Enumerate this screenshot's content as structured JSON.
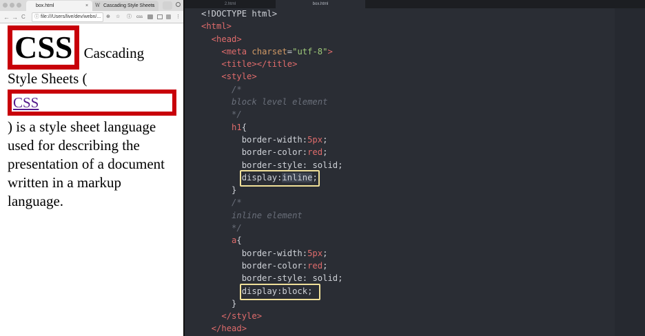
{
  "browser": {
    "tabs": [
      {
        "label": "box.html",
        "active": true,
        "close": "×"
      },
      {
        "label": "Cascading Style Sheets",
        "active": false,
        "close": "×",
        "favicon": "W"
      }
    ],
    "nav": {
      "back": "←",
      "forward": "→",
      "reload": "C"
    },
    "address": {
      "info_icon": "ⓘ",
      "url": "file:///Users/live/dev/webn/..."
    },
    "toolbar_icons": {
      "zoom": "⊕",
      "star": "☆",
      "info": "ⓘ",
      "ext": "css",
      "menu": "⋮"
    },
    "page": {
      "h1": "CSS",
      "text_before": "Cascading Style Sheets (",
      "link": "CSS",
      "text_after": ") is a style sheet language used for describing the presentation of a document written in a markup language."
    }
  },
  "editor": {
    "tabs": [
      {
        "label": "2.html",
        "active": false
      },
      {
        "label": "box.html",
        "active": true
      }
    ],
    "code": {
      "doctype": "<!DOCTYPE html>",
      "html_open": "<html>",
      "head_open": "<head>",
      "meta_lt": "<",
      "meta_tag": "meta",
      "meta_attr": "charset",
      "meta_eq": "=",
      "meta_val": "\"utf-8\"",
      "meta_gt": ">",
      "title_tags": "<title></title>",
      "style_open": "<style>",
      "comment_open": "/*",
      "comment1": "block level element",
      "comment_close": "*/",
      "h1_selector": "h1",
      "open_brace": "{",
      "bw_prop": "border-width:",
      "bw_val": "5px",
      "bc_prop": "border-color:",
      "bc_val": "red",
      "bs_prop": "border-style:",
      "bs_val": "solid",
      "semi": ";",
      "disp_prop": "display:",
      "disp_inline": "inline",
      "close_brace": "}",
      "comment2": "inline element",
      "a_selector": "a",
      "disp_block": "block",
      "style_close": "</style>",
      "head_close": "</head>"
    }
  },
  "colors": {
    "border_red": "#c8000a",
    "link_visited": "#551a8b",
    "highlight_box": "#f1e19a",
    "editor_bg": "#2a2d34"
  }
}
